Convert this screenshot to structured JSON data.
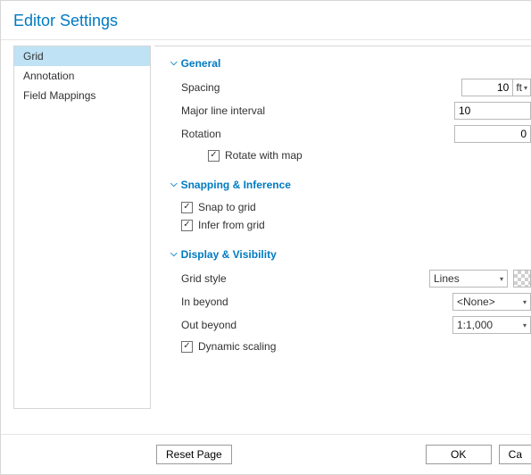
{
  "dialog": {
    "title": "Editor Settings"
  },
  "sidebar": {
    "items": [
      {
        "label": "Grid",
        "selected": true
      },
      {
        "label": "Annotation",
        "selected": false
      },
      {
        "label": "Field Mappings",
        "selected": false
      }
    ]
  },
  "sections": {
    "general": {
      "title": "General",
      "spacing": {
        "label": "Spacing",
        "value": "10",
        "unit": "ft"
      },
      "major_interval": {
        "label": "Major line interval",
        "value": "10"
      },
      "rotation": {
        "label": "Rotation",
        "value": "0"
      },
      "rotate_with_map": {
        "label": "Rotate with map",
        "checked": true
      }
    },
    "snapping": {
      "title": "Snapping & Inference",
      "snap_to_grid": {
        "label": "Snap to grid",
        "checked": true
      },
      "infer_from_grid": {
        "label": "Infer from grid",
        "checked": true
      }
    },
    "display": {
      "title": "Display & Visibility",
      "grid_style": {
        "label": "Grid style",
        "value": "Lines"
      },
      "in_beyond": {
        "label": "In beyond",
        "value": "<None>"
      },
      "out_beyond": {
        "label": "Out beyond",
        "value": "1:1,000"
      },
      "dynamic_scaling": {
        "label": "Dynamic scaling",
        "checked": true
      }
    }
  },
  "footer": {
    "reset": "Reset Page",
    "ok": "OK",
    "cancel": "Ca"
  },
  "colors": {
    "accent": "#007ac2",
    "selected_bg": "#bfe2f4"
  }
}
